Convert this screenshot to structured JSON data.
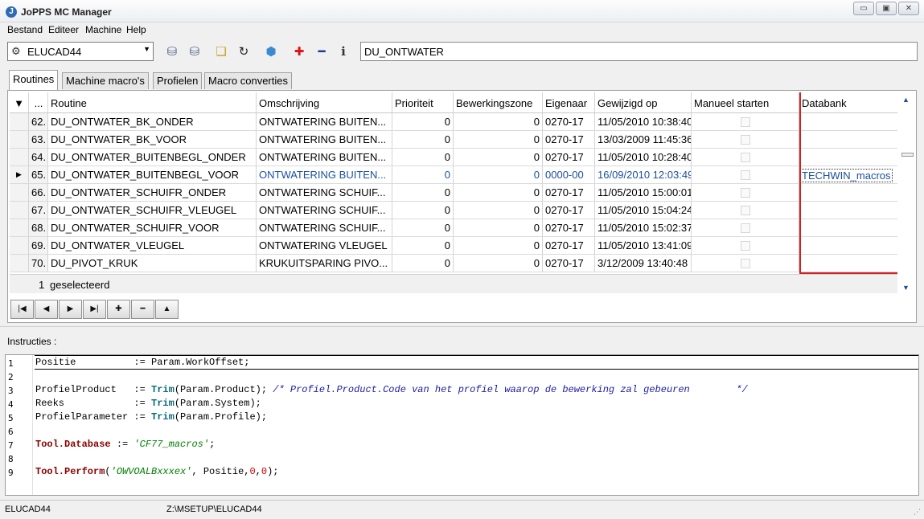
{
  "window": {
    "title": "JoPPS MC Manager",
    "minimize": "▭",
    "restore": "▣",
    "close": "✕"
  },
  "menu": [
    "Bestand",
    "Editeer",
    "Machine",
    "Help"
  ],
  "toolbar": {
    "machine": "ELUCAD44",
    "search_value": "DU_ONTWATER",
    "buttons": [
      {
        "name": "db-export-icon",
        "glyph": "⛁",
        "color": "#4a5a8a"
      },
      {
        "name": "db-import-icon",
        "glyph": "⛁",
        "color": "#4a5a8a"
      },
      {
        "name": "copy-files-icon",
        "glyph": "❏",
        "color": "#c8a020"
      },
      {
        "name": "refresh-icon",
        "glyph": "↻",
        "color": "#222222"
      },
      {
        "name": "package-icon",
        "glyph": "⬢",
        "color": "#3a8ad0"
      },
      {
        "name": "add-icon",
        "glyph": "✚",
        "color": "#dd1111"
      },
      {
        "name": "remove-icon",
        "glyph": "━",
        "color": "#1a3aa0"
      },
      {
        "name": "info-icon",
        "glyph": "ℹ",
        "color": "#333333"
      }
    ]
  },
  "tabs": [
    "Routines",
    "Machine macro's",
    "Profielen",
    "Macro converties"
  ],
  "grid": {
    "columns": {
      "nr": "...",
      "routine": "Routine",
      "omschrijving": "Omschrijving",
      "prioriteit": "Prioriteit",
      "zone": "Bewerkingszone",
      "eigenaar": "Eigenaar",
      "gewijzigd": "Gewijzigd op",
      "manueel": "Manueel starten",
      "databank": "Databank"
    },
    "rows": [
      {
        "nr": "62.",
        "routine": "DU_ONTWATER_BK_ONDER",
        "omschrijving": "ONTWATERING BUITEN...",
        "prioriteit": "0",
        "zone": "0",
        "eigenaar": "0270-17",
        "gewijzigd": "11/05/2010 10:38:40",
        "databank": ""
      },
      {
        "nr": "63.",
        "routine": "DU_ONTWATER_BK_VOOR",
        "omschrijving": "ONTWATERING BUITEN...",
        "prioriteit": "0",
        "zone": "0",
        "eigenaar": "0270-17",
        "gewijzigd": "13/03/2009 11:45:36",
        "databank": ""
      },
      {
        "nr": "64.",
        "routine": "DU_ONTWATER_BUITENBEGL_ONDER",
        "omschrijving": "ONTWATERING BUITEN...",
        "prioriteit": "0",
        "zone": "0",
        "eigenaar": "0270-17",
        "gewijzigd": "11/05/2010 10:28:40",
        "databank": ""
      },
      {
        "nr": "65.",
        "routine": "DU_ONTWATER_BUITENBEGL_VOOR",
        "omschrijving": "ONTWATERING BUITEN...",
        "prioriteit": "0",
        "zone": "0",
        "eigenaar": "0000-00",
        "gewijzigd": "16/09/2010 12:03:49",
        "databank": "TECHWIN_macros"
      },
      {
        "nr": "66.",
        "routine": "DU_ONTWATER_SCHUIFR_ONDER",
        "omschrijving": "ONTWATERING SCHUIF...",
        "prioriteit": "0",
        "zone": "0",
        "eigenaar": "0270-17",
        "gewijzigd": "11/05/2010 15:00:01",
        "databank": ""
      },
      {
        "nr": "67.",
        "routine": "DU_ONTWATER_SCHUIFR_VLEUGEL",
        "omschrijving": "ONTWATERING SCHUIF...",
        "prioriteit": "0",
        "zone": "0",
        "eigenaar": "0270-17",
        "gewijzigd": "11/05/2010 15:04:24",
        "databank": ""
      },
      {
        "nr": "68.",
        "routine": "DU_ONTWATER_SCHUIFR_VOOR",
        "omschrijving": "ONTWATERING SCHUIF...",
        "prioriteit": "0",
        "zone": "0",
        "eigenaar": "0270-17",
        "gewijzigd": "11/05/2010 15:02:37",
        "databank": ""
      },
      {
        "nr": "69.",
        "routine": "DU_ONTWATER_VLEUGEL",
        "omschrijving": "ONTWATERING VLEUGEL",
        "prioriteit": "0",
        "zone": "0",
        "eigenaar": "0270-17",
        "gewijzigd": "11/05/2010 13:41:09",
        "databank": ""
      },
      {
        "nr": "70.",
        "routine": "DU_PIVOT_KRUK",
        "omschrijving": "KRUKUITSPARING PIVO...",
        "prioriteit": "0",
        "zone": "0",
        "eigenaar": "0270-17",
        "gewijzigd": "3/12/2009 13:40:48",
        "databank": ""
      }
    ],
    "selected_count": "1",
    "selected_label": "geselecteerd"
  },
  "navigator": [
    {
      "name": "first-record-button",
      "glyph": "|◀"
    },
    {
      "name": "prior-record-button",
      "glyph": "◀"
    },
    {
      "name": "next-record-button",
      "glyph": "▶"
    },
    {
      "name": "last-record-button",
      "glyph": "▶|"
    },
    {
      "name": "insert-record-button",
      "glyph": "✚"
    },
    {
      "name": "delete-record-button",
      "glyph": "━"
    },
    {
      "name": "edit-record-button",
      "glyph": "▲"
    }
  ],
  "instructions": {
    "label": "Instructies :",
    "lines": [
      [
        {
          "t": "Positie          := Param.WorkOffset;"
        }
      ],
      [],
      [
        {
          "t": "ProfielProduct   := "
        },
        {
          "t": "Trim",
          "c": "kw"
        },
        {
          "t": "(Param.Product); "
        },
        {
          "t": "/* Profiel.Product.Code van het profiel waarop de bewerking zal gebeuren        */",
          "c": "cm"
        }
      ],
      [
        {
          "t": "Reeks            := "
        },
        {
          "t": "Trim",
          "c": "kw"
        },
        {
          "t": "(Param.System);"
        }
      ],
      [
        {
          "t": "ProfielParameter := "
        },
        {
          "t": "Trim",
          "c": "kw"
        },
        {
          "t": "(Param.Profile);"
        }
      ],
      [],
      [
        {
          "t": "Tool.Database",
          "c": "obj"
        },
        {
          "t": " := "
        },
        {
          "t": "'CF77_macros'",
          "c": "str"
        },
        {
          "t": ";"
        }
      ],
      [],
      [
        {
          "t": "Tool.Perform",
          "c": "obj"
        },
        {
          "t": "("
        },
        {
          "t": "'OWVOALBxxxex'",
          "c": "str"
        },
        {
          "t": ", Positie,"
        },
        {
          "t": "0",
          "c": "nm"
        },
        {
          "t": ","
        },
        {
          "t": "0",
          "c": "nm"
        },
        {
          "t": ");"
        }
      ]
    ]
  },
  "statusbar": {
    "machine": "ELUCAD44",
    "path": "Z:\\MSETUP\\ELUCAD44"
  }
}
